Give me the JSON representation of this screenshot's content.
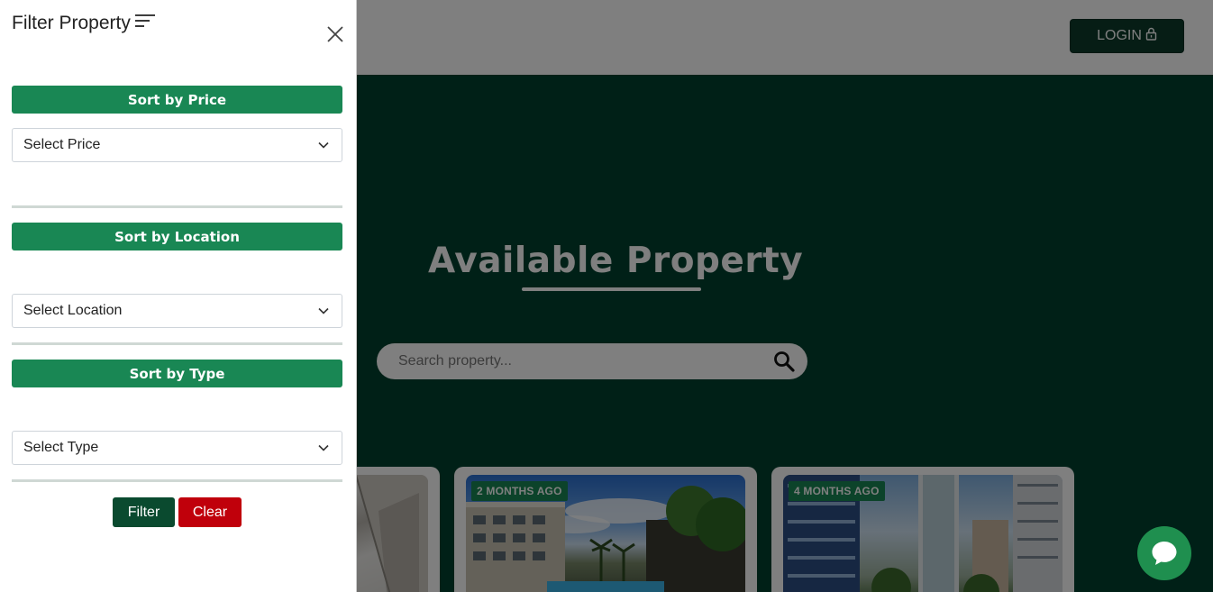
{
  "header": {
    "login_label": "LOGIN"
  },
  "hero": {
    "title": "Available Property",
    "search_placeholder": "Search property..."
  },
  "cards": [
    {
      "badge": ""
    },
    {
      "badge": "2 MONTHS AGO"
    },
    {
      "badge": "4 MONTHS AGO"
    }
  ],
  "filter_panel": {
    "title": "Filter Property",
    "sections": [
      {
        "header": "Sort by Price",
        "select_value": "Select Price"
      },
      {
        "header": "Sort by Location",
        "select_value": "Select Location"
      },
      {
        "header": "Sort by Type",
        "select_value": "Select Type"
      }
    ],
    "filter_label": "Filter",
    "clear_label": "Clear"
  },
  "icons": {
    "lock": "lock-icon",
    "search": "search-icon",
    "close": "close-icon",
    "sort": "sort-lines-icon",
    "chevron": "chevron-down-icon",
    "chat": "chat-bubble-icon"
  },
  "colors": {
    "primary_green": "#198754",
    "dark_green": "#01412e",
    "filter_button": "#0a4a2f",
    "clear_button": "#c0000b",
    "chat_button": "#1f8f4f"
  }
}
